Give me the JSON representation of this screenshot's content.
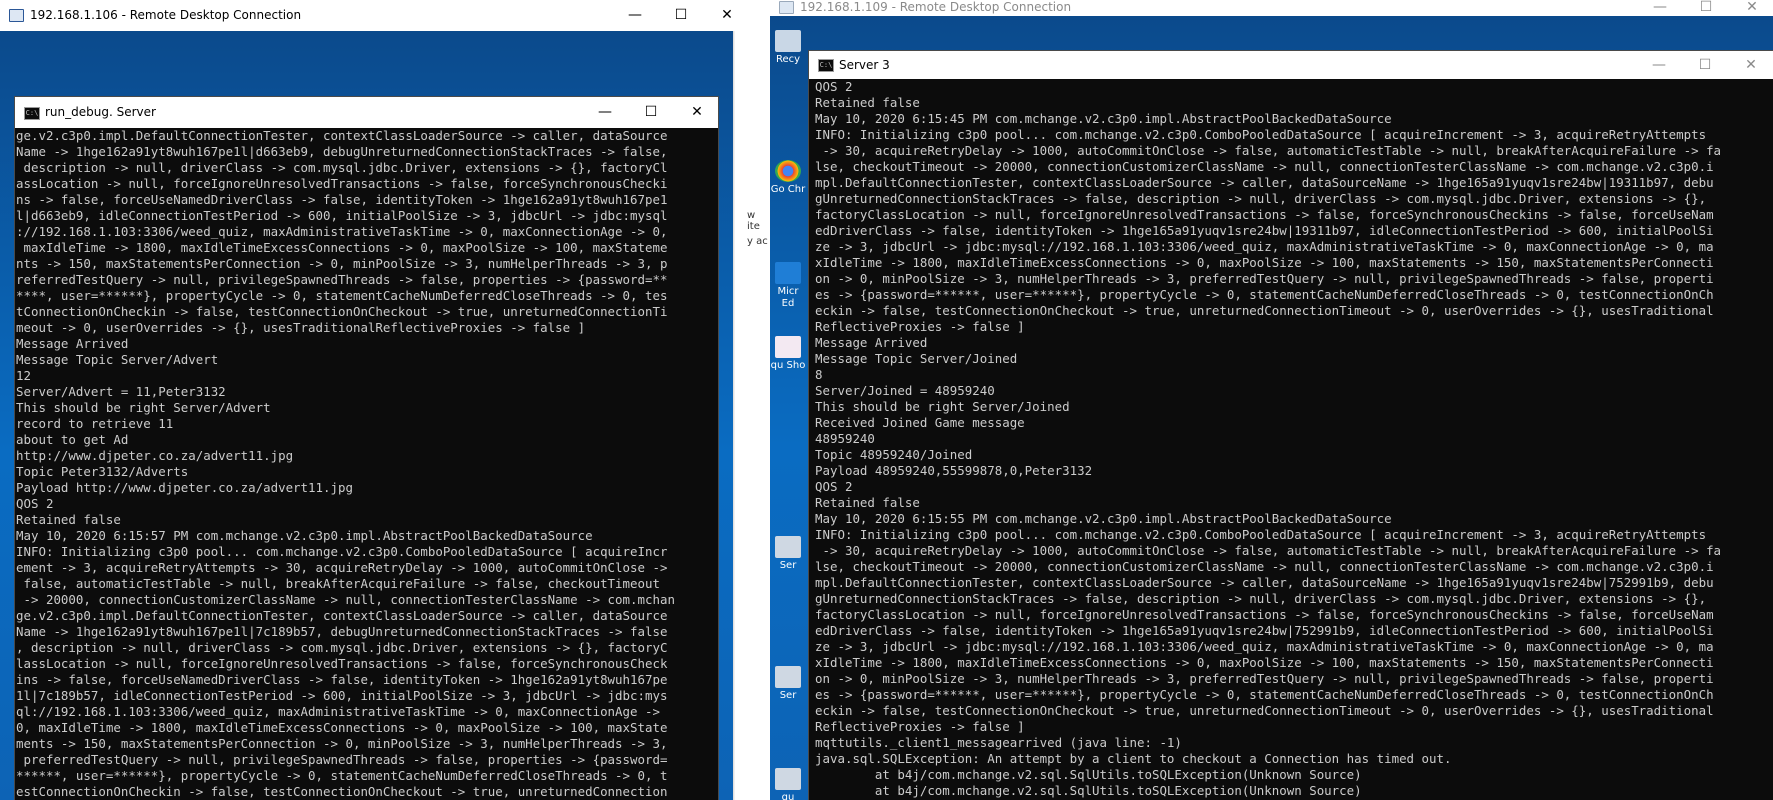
{
  "left_rdp": {
    "title": "192.168.1.106 - Remote Desktop Connection",
    "controls": {
      "minimize": "—",
      "maximize": "☐",
      "close": "✕"
    },
    "scroll": {
      "up": "▲",
      "down": "▼"
    }
  },
  "left_console": {
    "title": "run_debug. Server",
    "icon": "C:\\",
    "controls": {
      "minimize": "—",
      "maximize": "☐",
      "close": "✕"
    },
    "lines": [
      "ge.v2.c3p0.impl.DefaultConnectionTester, contextClassLoaderSource -> caller, dataSource",
      "Name -> 1hge162a91yt8wuh167pe1l|d663eb9, debugUnreturnedConnectionStackTraces -> false,",
      " description -> null, driverClass -> com.mysql.jdbc.Driver, extensions -> {}, factoryCl",
      "assLocation -> null, forceIgnoreUnresolvedTransactions -> false, forceSynchronousChecki",
      "ns -> false, forceUseNamedDriverClass -> false, identityToken -> 1hge162a91yt8wuh167pe1",
      "l|d663eb9, idleConnectionTestPeriod -> 600, initialPoolSize -> 3, jdbcUrl -> jdbc:mysql",
      "://192.168.1.103:3306/weed_quiz, maxAdministrativeTaskTime -> 0, maxConnectionAge -> 0,",
      " maxIdleTime -> 1800, maxIdleTimeExcessConnections -> 0, maxPoolSize -> 100, maxStateme",
      "nts -> 150, maxStatementsPerConnection -> 0, minPoolSize -> 3, numHelperThreads -> 3, p",
      "referredTestQuery -> null, privilegeSpawnedThreads -> false, properties -> {password=**",
      "****, user=******}, propertyCycle -> 0, statementCacheNumDeferredCloseThreads -> 0, tes",
      "tConnectionOnCheckin -> false, testConnectionOnCheckout -> true, unreturnedConnectionTi",
      "meout -> 0, userOverrides -> {}, usesTraditionalReflectiveProxies -> false ]",
      "Message Arrived",
      "Message Topic Server/Advert",
      "12",
      "Server/Advert = 11,Peter3132",
      "This should be right Server/Advert",
      "record to retrieve 11",
      "about to get Ad",
      "http://www.djpeter.co.za/advert11.jpg",
      "Topic Peter3132/Adverts",
      "Payload http://www.djpeter.co.za/advert11.jpg",
      "QOS 2",
      "Retained false",
      "May 10, 2020 6:15:57 PM com.mchange.v2.c3p0.impl.AbstractPoolBackedDataSource",
      "INFO: Initializing c3p0 pool... com.mchange.v2.c3p0.ComboPooledDataSource [ acquireIncr",
      "ement -> 3, acquireRetryAttempts -> 30, acquireRetryDelay -> 1000, autoCommitOnClose ->",
      " false, automaticTestTable -> null, breakAfterAcquireFailure -> false, checkoutTimeout",
      " -> 20000, connectionCustomizerClassName -> null, connectionTesterClassName -> com.mchan",
      "ge.v2.c3p0.impl.DefaultConnectionTester, contextClassLoaderSource -> caller, dataSource",
      "Name -> 1hge162a91yt8wuh167pe1l|7c189b57, debugUnreturnedConnectionStackTraces -> false",
      ", description -> null, driverClass -> com.mysql.jdbc.Driver, extensions -> {}, factoryC",
      "lassLocation -> null, forceIgnoreUnresolvedTransactions -> false, forceSynchronousCheck",
      "ins -> false, forceUseNamedDriverClass -> false, identityToken -> 1hge162a91yt8wuh167pe",
      "1l|7c189b57, idleConnectionTestPeriod -> 600, initialPoolSize -> 3, jdbcUrl -> jdbc:mys",
      "ql://192.168.1.103:3306/weed_quiz, maxAdministrativeTaskTime -> 0, maxConnectionAge ->",
      "0, maxIdleTime -> 1800, maxIdleTimeExcessConnections -> 0, maxPoolSize -> 100, maxState",
      "ments -> 150, maxStatementsPerConnection -> 0, minPoolSize -> 3, numHelperThreads -> 3,",
      " preferredTestQuery -> null, privilegeSpawnedThreads -> false, properties -> {password=",
      "******, user=******}, propertyCycle -> 0, statementCacheNumDeferredCloseThreads -> 0, t",
      "estConnectionOnCheckin -> false, testConnectionOnCheckout -> true, unreturnedConnection"
    ]
  },
  "middle_strip": {
    "fragment_1": "w ite",
    "fragment_2": "y ac"
  },
  "right_rdp": {
    "title": "192.168.1.109 - Remote Desktop Connection",
    "controls": {
      "minimize": "—",
      "maximize": "☐",
      "close": "✕"
    },
    "desktop_icons": [
      "Recy",
      "Go Chr",
      "Micr Ed",
      "qu Sho",
      "Ser",
      "Ser",
      "qu"
    ]
  },
  "right_console": {
    "title": "Server 3",
    "icon": "C:\\",
    "controls": {
      "minimize": "—",
      "maximize": "☐",
      "close": "✕"
    },
    "lines": [
      "QOS 2",
      "Retained false",
      "May 10, 2020 6:15:45 PM com.mchange.v2.c3p0.impl.AbstractPoolBackedDataSource",
      "INFO: Initializing c3p0 pool... com.mchange.v2.c3p0.ComboPooledDataSource [ acquireIncrement -> 3, acquireRetryAttempts",
      " -> 30, acquireRetryDelay -> 1000, autoCommitOnClose -> false, automaticTestTable -> null, breakAfterAcquireFailure -> fa",
      "lse, checkoutTimeout -> 20000, connectionCustomizerClassName -> null, connectionTesterClassName -> com.mchange.v2.c3p0.i",
      "mpl.DefaultConnectionTester, contextClassLoaderSource -> caller, dataSourceName -> 1hge165a91yuqv1sre24bw|19311b97, debu",
      "gUnreturnedConnectionStackTraces -> false, description -> null, driverClass -> com.mysql.jdbc.Driver, extensions -> {},",
      "factoryClassLocation -> null, forceIgnoreUnresolvedTransactions -> false, forceSynchronousCheckins -> false, forceUseNam",
      "edDriverClass -> false, identityToken -> 1hge165a91yuqv1sre24bw|19311b97, idleConnectionTestPeriod -> 600, initialPoolSi",
      "ze -> 3, jdbcUrl -> jdbc:mysql://192.168.1.103:3306/weed_quiz, maxAdministrativeTaskTime -> 0, maxConnectionAge -> 0, ma",
      "xIdleTime -> 1800, maxIdleTimeExcessConnections -> 0, maxPoolSize -> 100, maxStatements -> 150, maxStatementsPerConnecti",
      "on -> 0, minPoolSize -> 3, numHelperThreads -> 3, preferredTestQuery -> null, privilegeSpawnedThreads -> false, properti",
      "es -> {password=******, user=******}, propertyCycle -> 0, statementCacheNumDeferredCloseThreads -> 0, testConnectionOnCh",
      "eckin -> false, testConnectionOnCheckout -> true, unreturnedConnectionTimeout -> 0, userOverrides -> {}, usesTraditional",
      "ReflectiveProxies -> false ]",
      "Message Arrived",
      "Message Topic Server/Joined",
      "8",
      "Server/Joined = 48959240",
      "This should be right Server/Joined",
      "Received Joined Game message",
      "48959240",
      "Topic 48959240/Joined",
      "Payload 48959240,55599878,0,Peter3132",
      "QOS 2",
      "Retained false",
      "May 10, 2020 6:15:55 PM com.mchange.v2.c3p0.impl.AbstractPoolBackedDataSource",
      "INFO: Initializing c3p0 pool... com.mchange.v2.c3p0.ComboPooledDataSource [ acquireIncrement -> 3, acquireRetryAttempts",
      " -> 30, acquireRetryDelay -> 1000, autoCommitOnClose -> false, automaticTestTable -> null, breakAfterAcquireFailure -> fa",
      "lse, checkoutTimeout -> 20000, connectionCustomizerClassName -> null, connectionTesterClassName -> com.mchange.v2.c3p0.i",
      "mpl.DefaultConnectionTester, contextClassLoaderSource -> caller, dataSourceName -> 1hge165a91yuqv1sre24bw|752991b9, debu",
      "gUnreturnedConnectionStackTraces -> false, description -> null, driverClass -> com.mysql.jdbc.Driver, extensions -> {},",
      "factoryClassLocation -> null, forceIgnoreUnresolvedTransactions -> false, forceSynchronousCheckins -> false, forceUseNam",
      "edDriverClass -> false, identityToken -> 1hge165a91yuqv1sre24bw|752991b9, idleConnectionTestPeriod -> 600, initialPoolSi",
      "ze -> 3, jdbcUrl -> jdbc:mysql://192.168.1.103:3306/weed_quiz, maxAdministrativeTaskTime -> 0, maxConnectionAge -> 0, ma",
      "xIdleTime -> 1800, maxIdleTimeExcessConnections -> 0, maxPoolSize -> 100, maxStatements -> 150, maxStatementsPerConnecti",
      "on -> 0, minPoolSize -> 3, numHelperThreads -> 3, preferredTestQuery -> null, privilegeSpawnedThreads -> false, properti",
      "es -> {password=******, user=******}, propertyCycle -> 0, statementCacheNumDeferredCloseThreads -> 0, testConnectionOnCh",
      "eckin -> false, testConnectionOnCheckout -> true, unreturnedConnectionTimeout -> 0, userOverrides -> {}, usesTraditional",
      "ReflectiveProxies -> false ]",
      "mqttutils._client1_messagearrived (java line: -1)",
      "java.sql.SQLException: An attempt by a client to checkout a Connection has timed out.",
      "        at b4j/com.mchange.v2.sql.SqlUtils.toSQLException(Unknown Source)",
      "        at b4j/com.mchange.v2.sql.SqlUtils.toSQLException(Unknown Source)"
    ]
  }
}
